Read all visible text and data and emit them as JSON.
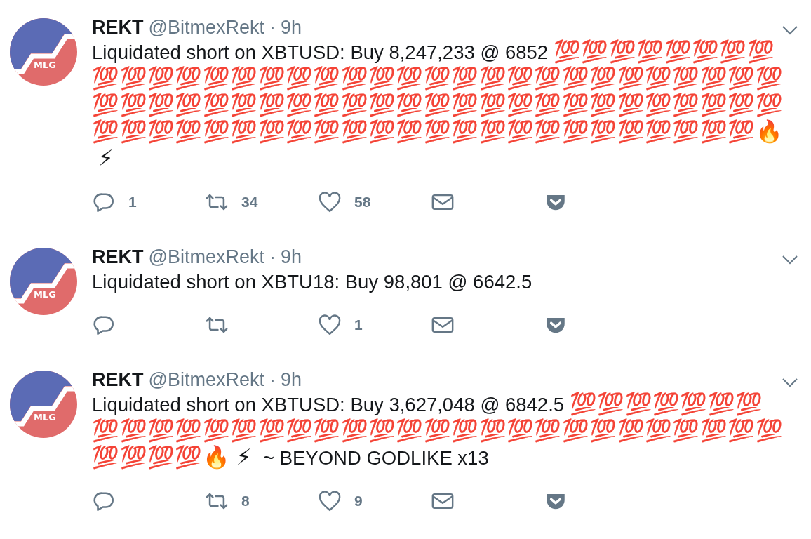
{
  "separator": "·",
  "tweets": [
    {
      "avatar_text": "MLG",
      "name": "REKT",
      "handle": "@BitmexRekt",
      "time": "9h",
      "body": "Liquidated short on XBTUSD: Buy 8,247,233 @ 6852 💯💯💯💯💯💯💯💯💯💯💯💯💯💯💯💯💯💯💯💯💯💯💯💯💯💯💯💯💯💯💯💯💯💯💯💯💯💯💯💯💯💯💯💯💯💯💯💯💯💯💯💯💯💯💯💯💯💯💯💯💯💯💯💯💯💯💯💯💯💯💯💯💯💯💯💯💯💯💯💯💯💯🔥⚡",
      "replies": "1",
      "retweets": "34",
      "likes": "58"
    },
    {
      "avatar_text": "MLG",
      "name": "REKT",
      "handle": "@BitmexRekt",
      "time": "9h",
      "body": "Liquidated short on XBTU18: Buy 98,801 @ 6642.5",
      "likes": "1"
    },
    {
      "avatar_text": "MLG",
      "name": "REKT",
      "handle": "@BitmexRekt",
      "time": "9h",
      "body": "Liquidated short on XBTUSD: Buy 3,627,048 @ 6842.5 💯💯💯💯💯💯💯💯💯💯💯💯💯💯💯💯💯💯💯💯💯💯💯💯💯💯💯💯💯💯💯💯💯💯💯💯🔥⚡ ~ BEYOND GODLIKE x13",
      "retweets": "8",
      "likes": "9"
    }
  ]
}
